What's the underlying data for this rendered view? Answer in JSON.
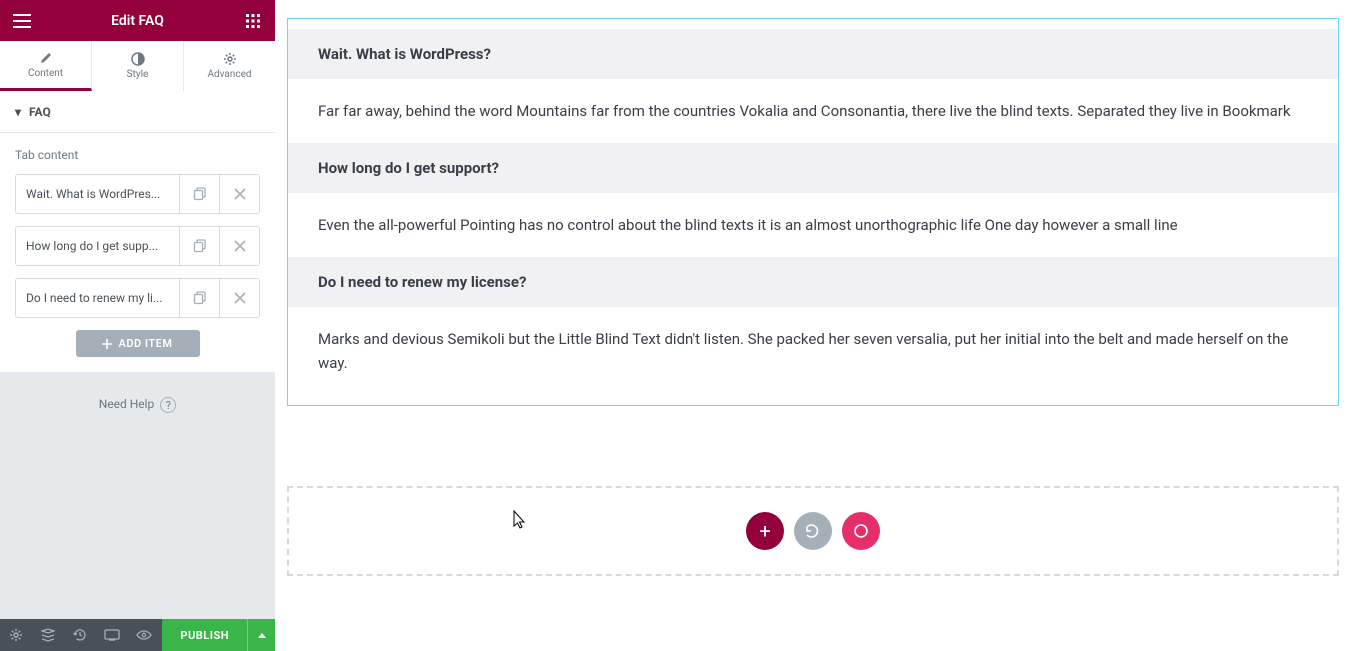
{
  "header": {
    "title": "Edit FAQ"
  },
  "tabs": [
    {
      "label": "Content"
    },
    {
      "label": "Style"
    },
    {
      "label": "Advanced"
    }
  ],
  "section": {
    "title": "FAQ",
    "field_label": "Tab content",
    "items": [
      {
        "label": "Wait. What is WordPres..."
      },
      {
        "label": "How long do I get supp..."
      },
      {
        "label": "Do I need to renew my li..."
      }
    ],
    "add_label": "ADD ITEM"
  },
  "help_label": "Need Help",
  "footer": {
    "publish_label": "PUBLISH"
  },
  "canvas": {
    "faq": [
      {
        "q": "Wait. What is WordPress?",
        "a": "Far far away, behind the word Mountains far from the countries Vokalia and Consonantia, there live the blind texts. Separated they live in Bookmark"
      },
      {
        "q": "How long do I get support?",
        "a": "Even the all-powerful Pointing has no control about the blind texts it is an almost unorthographic life One day however a small line"
      },
      {
        "q": "Do I need to renew my license?",
        "a": "Marks and devious Semikoli but the Little Blind Text didn't listen. She packed her seven versalia, put her initial into the belt and made herself on the way."
      }
    ]
  },
  "colors": {
    "circ1": "#93003c",
    "circ2": "#a4afb7",
    "circ3": "#e62e6b"
  }
}
